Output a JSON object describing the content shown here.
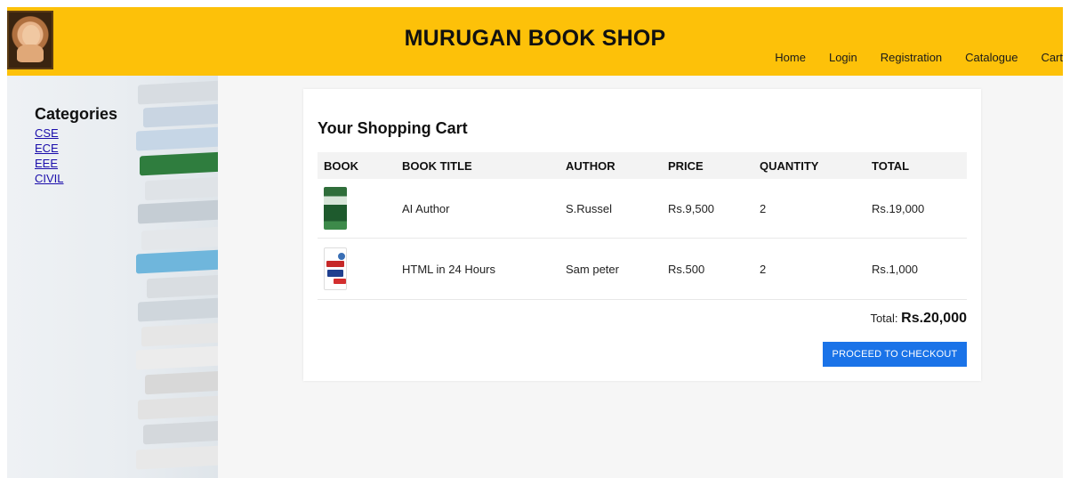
{
  "header": {
    "site_title": "MURUGAN BOOK SHOP",
    "logo_icon": "child-portrait-logo",
    "nav": [
      "Home",
      "Login",
      "Registration",
      "Catalogue",
      "Cart"
    ],
    "background_color": "#fdc109"
  },
  "sidebar": {
    "title": "Categories",
    "categories": [
      "CSE",
      "ECE",
      "EEE",
      "CIVIL"
    ]
  },
  "cart": {
    "title": "Your Shopping Cart",
    "columns": [
      "BOOK",
      "BOOK TITLE",
      "AUTHOR",
      "PRICE",
      "QUANTITY",
      "TOTAL"
    ],
    "rows": [
      {
        "cover_icon": "ai-book-cover-icon",
        "title": "AI Author",
        "author": "S.Russel",
        "price": "Rs.9,500",
        "quantity": "2",
        "total": "Rs.19,000"
      },
      {
        "cover_icon": "html-book-cover-icon",
        "title": "HTML in 24 Hours",
        "author": "Sam peter",
        "price": "Rs.500",
        "quantity": "2",
        "total": "Rs.1,000"
      }
    ],
    "total_label": "Total:",
    "total_value": "Rs.20,000",
    "checkout_label": "PROCEED TO CHECKOUT",
    "checkout_color": "#1a73e8"
  }
}
